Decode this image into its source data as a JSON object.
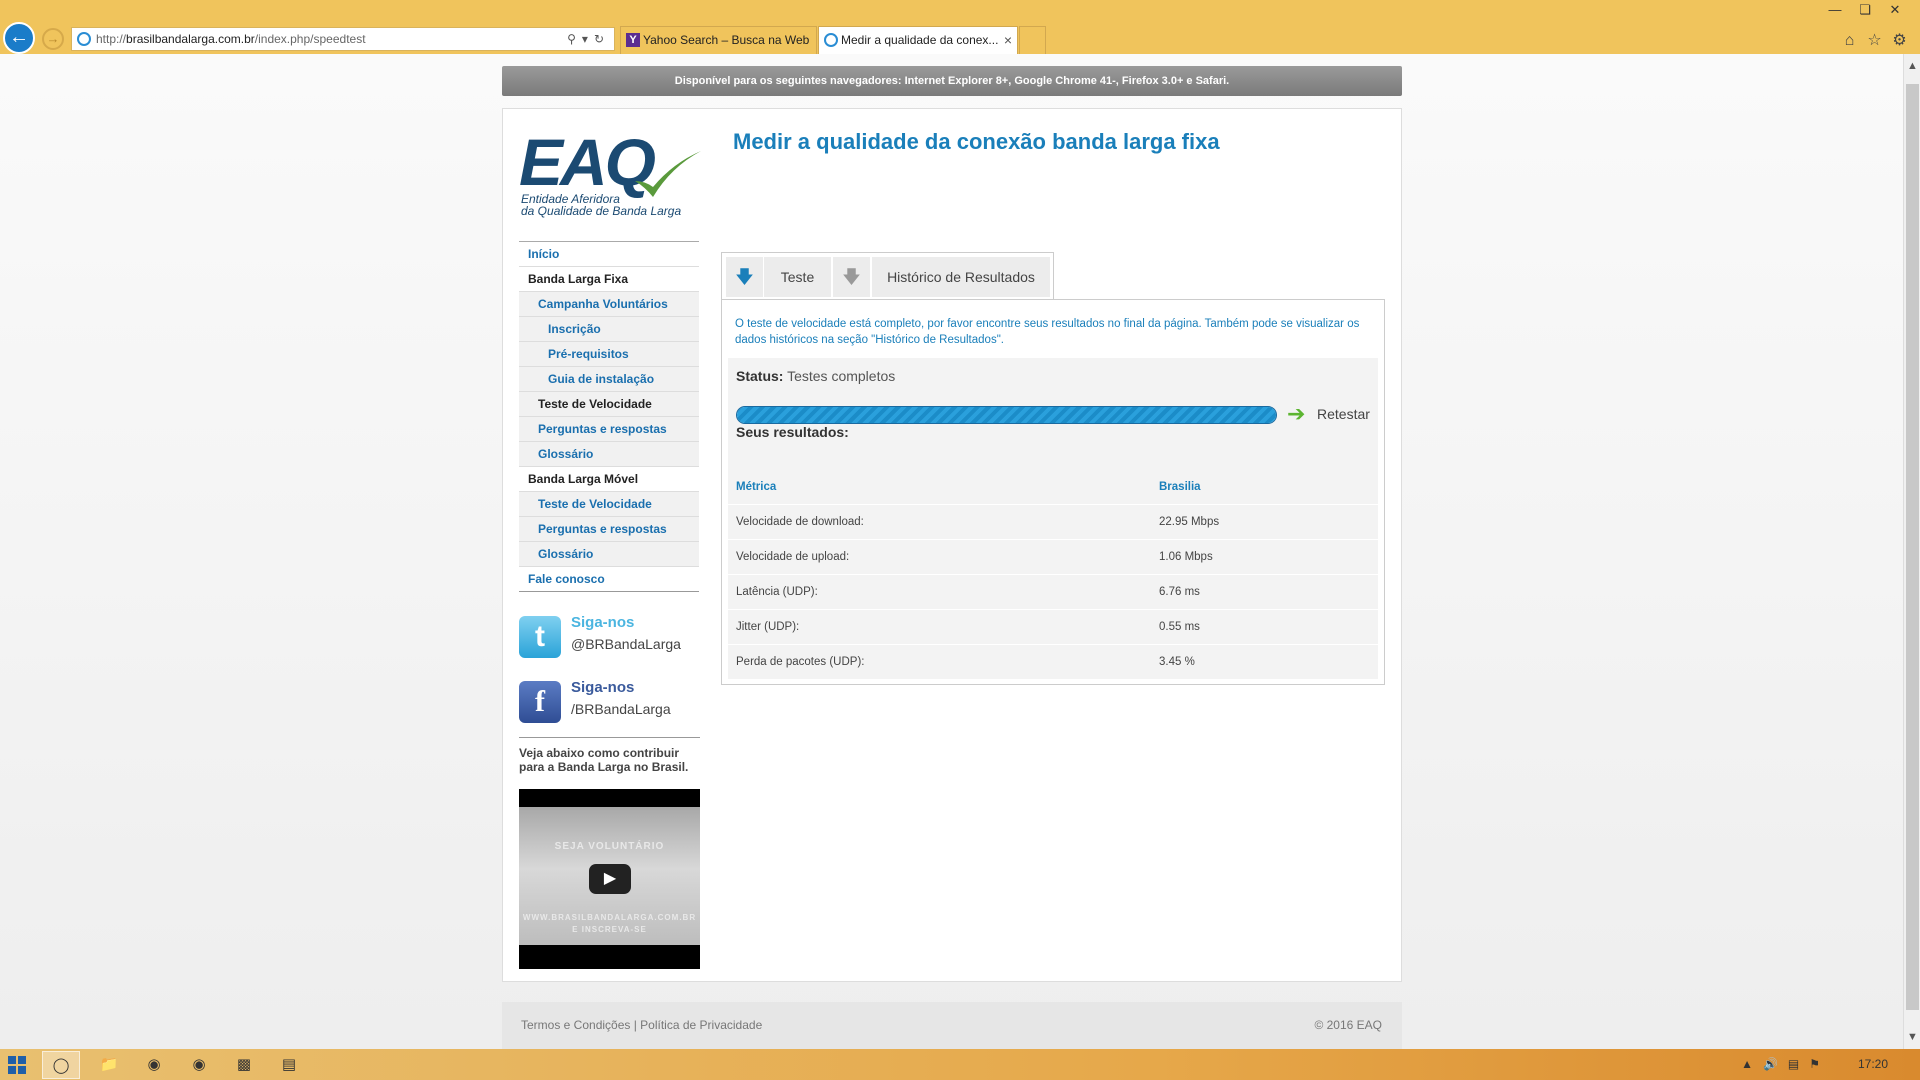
{
  "browser": {
    "url_prefix": "http://",
    "url_host": "brasilbandalarga.com.br",
    "url_path": "/index.php/speedtest",
    "tabs": [
      {
        "label": "Yahoo Search – Busca na Web",
        "icon": "yahoo-icon"
      },
      {
        "label": "Medir a qualidade da conex...",
        "icon": "ie-icon"
      }
    ]
  },
  "notice": "Disponível para os seguintes navegadores: Internet Explorer 8+, Google Chrome 41-, Firefox 3.0+ e Safari.",
  "logo": {
    "main": "EAQ",
    "line1": "Entidade Aferidora",
    "line2": "da Qualidade de Banda Larga"
  },
  "sidebar": {
    "items": [
      {
        "label": "Início",
        "level": 0,
        "style": "link"
      },
      {
        "label": "Banda Larga Fixa",
        "level": 0,
        "style": "dark"
      },
      {
        "label": "Campanha Voluntários",
        "level": 1,
        "style": "link"
      },
      {
        "label": "Inscrição",
        "level": 2,
        "style": "link"
      },
      {
        "label": "Pré-requisitos",
        "level": 2,
        "style": "link"
      },
      {
        "label": "Guia de instalação",
        "level": 2,
        "style": "link"
      },
      {
        "label": "Teste de Velocidade",
        "level": 1,
        "style": "dark"
      },
      {
        "label": "Perguntas e respostas",
        "level": 1,
        "style": "link"
      },
      {
        "label": "Glossário",
        "level": 1,
        "style": "link"
      },
      {
        "label": "Banda Larga Móvel",
        "level": 0,
        "style": "dark"
      },
      {
        "label": "Teste de Velocidade",
        "level": 1,
        "style": "link"
      },
      {
        "label": "Perguntas e respostas",
        "level": 1,
        "style": "link"
      },
      {
        "label": "Glossário",
        "level": 1,
        "style": "link"
      },
      {
        "label": "Fale conosco",
        "level": 0,
        "style": "link"
      }
    ]
  },
  "social": {
    "twitter": {
      "title": "Siga-nos",
      "handle": "@BRBandaLarga"
    },
    "facebook": {
      "title": "Siga-nos",
      "handle": "/BRBandaLarga"
    }
  },
  "contrib_text": "Veja abaixo como contribuir para a Banda Larga no Brasil.",
  "video": {
    "line1": "SEJA VOLUNTÁRIO",
    "line2": "WWW.BRASILBANDALARGA.COM.BR",
    "line3": "E INSCREVA-SE"
  },
  "main": {
    "heading": "Medir a qualidade da conexão banda larga fixa",
    "tabs": {
      "test": "Teste",
      "history": "Histórico de Resultados"
    },
    "message": "O teste de velocidade está completo, por favor encontre seus resultados no final da página. Também pode se visualizar os dados históricos na seção \"Histórico de Resultados\".",
    "status_label": "Status:",
    "status_value": "Testes completos",
    "progress_percent": 100,
    "retest_label": "Retestar",
    "results_title": "Seus resultados:",
    "results_header": {
      "metric": "Métrica",
      "location": "Brasilia"
    },
    "results": [
      {
        "metric": "Velocidade de download:",
        "value": "22.95 Mbps"
      },
      {
        "metric": "Velocidade de upload:",
        "value": "1.06 Mbps"
      },
      {
        "metric": "Latência (UDP):",
        "value": "6.76 ms"
      },
      {
        "metric": "Jitter (UDP):",
        "value": "0.55 ms"
      },
      {
        "metric": "Perda de pacotes (UDP):",
        "value": "3.45 %"
      }
    ]
  },
  "footer": {
    "left": "Termos e Condições | Política de Privacidade",
    "right": "© 2016 EAQ"
  },
  "taskbar": {
    "clock": "17:20"
  },
  "colors": {
    "accent": "#1a7fba",
    "logo": "#1b4a72",
    "check": "#5a9a3c",
    "chrome": "#f0c45c"
  }
}
